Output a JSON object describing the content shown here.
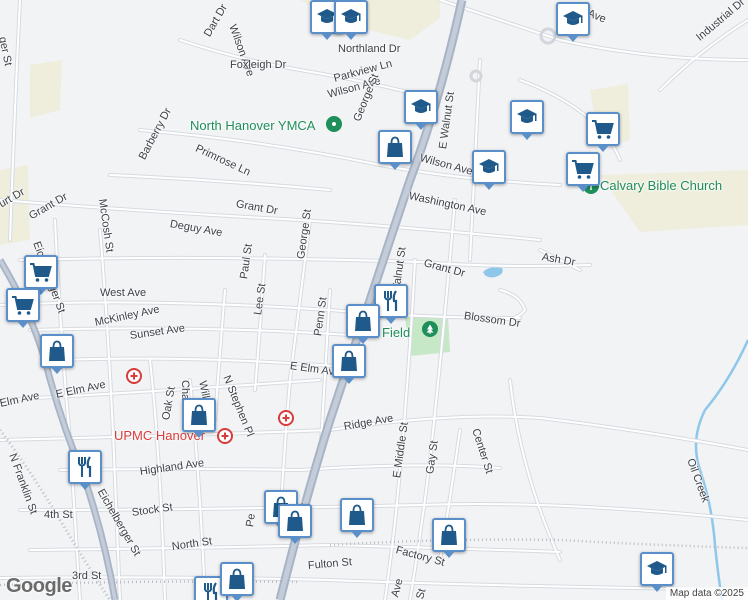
{
  "map": {
    "colors": {
      "background": "#f2f3f5",
      "road": "#ffffff",
      "road_casing": "#d2d6dc",
      "highway": "#a8b4c4",
      "railway": "#b9bec6",
      "water": "#8ec7ea",
      "park": "#c6e8c6",
      "land_tan": "#efeedd",
      "pin_fill": "#1f5a8a",
      "pin_border": "#5b8fc9",
      "poi_green": "#1e8e5a",
      "poi_red": "#d93c3c"
    },
    "street_labels": [
      {
        "text": "Wilson Ave"
      },
      {
        "text": "Dart Dr"
      },
      {
        "text": "Foxleigh Dr"
      },
      {
        "text": "Northland Dr"
      },
      {
        "text": "Parkview Ln"
      },
      {
        "text": "Wilson Ave"
      },
      {
        "text": "George St"
      },
      {
        "text": "E Walnut St"
      },
      {
        "text": "Barberry Dr"
      },
      {
        "text": "Primrose Ln"
      },
      {
        "text": "McCosh St"
      },
      {
        "text": "Wilson Ave"
      },
      {
        "text": "Washington Ave"
      },
      {
        "text": "Grant Dr"
      },
      {
        "text": "Grant Dr"
      },
      {
        "text": "Deguy Ave"
      },
      {
        "text": "George St"
      },
      {
        "text": "Eichelberger St"
      },
      {
        "text": "Paul St"
      },
      {
        "text": "Grant Dr"
      },
      {
        "text": "Ash Dr"
      },
      {
        "text": "West Ave"
      },
      {
        "text": "Lee St"
      },
      {
        "text": "Penn St"
      },
      {
        "text": "Walnut St"
      },
      {
        "text": "McKinley Ave"
      },
      {
        "text": "Blossom Dr"
      },
      {
        "text": "Sunset Ave"
      },
      {
        "text": "N Stephen Pl"
      },
      {
        "text": "Willow St"
      },
      {
        "text": "E Elm Ave"
      },
      {
        "text": "E Elm Ave"
      },
      {
        "text": "Elm Ave"
      },
      {
        "text": "Oak St"
      },
      {
        "text": "Chas"
      },
      {
        "text": "Ridge Ave"
      },
      {
        "text": "E Middle St"
      },
      {
        "text": "Gay St"
      },
      {
        "text": "Center St"
      },
      {
        "text": "N Franklin St"
      },
      {
        "text": "Highland Ave"
      },
      {
        "text": "4th St"
      },
      {
        "text": "Stock St"
      },
      {
        "text": "Eichelberger St"
      },
      {
        "text": "Pe"
      },
      {
        "text": "way"
      },
      {
        "text": "North St"
      },
      {
        "text": "3rd St"
      },
      {
        "text": "Fulton St"
      },
      {
        "text": "Factory St"
      },
      {
        "text": "Ave"
      },
      {
        "text": "Industrial Dr"
      },
      {
        "text": "Ave"
      },
      {
        "text": "Oil Creek"
      },
      {
        "text": "St"
      },
      {
        "text": "urt Dr"
      },
      {
        "text": "ger St"
      }
    ],
    "poi_labels": [
      {
        "text": "North Hanover YMCA",
        "icon": "fitness-icon",
        "color": "#1e8e5a"
      },
      {
        "text": "Calvary Bible Church",
        "icon": "church-icon",
        "color": "#1e8e5a"
      },
      {
        "text": "UPMC Hanover",
        "icon": "hospital-icon",
        "color": "#d93c3c"
      },
      {
        "text": "Field",
        "icon": "park-icon",
        "color": "#1e8e5a"
      }
    ],
    "extra_poi_icons": [
      {
        "icon": "hospital-icon"
      },
      {
        "icon": "hospital-icon"
      }
    ],
    "pins": [
      {
        "icon": "school-icon"
      },
      {
        "icon": "school-icon"
      },
      {
        "icon": "school-icon"
      },
      {
        "icon": "shopping-cart-icon"
      },
      {
        "icon": "school-icon"
      },
      {
        "icon": "shopping-bag-icon"
      },
      {
        "icon": "school-icon"
      },
      {
        "icon": "school-icon"
      },
      {
        "icon": "shopping-cart-icon"
      },
      {
        "icon": "shopping-cart-icon"
      },
      {
        "icon": "restaurant-icon"
      },
      {
        "icon": "shopping-cart-icon"
      },
      {
        "icon": "shopping-bag-icon"
      },
      {
        "icon": "shopping-bag-icon"
      },
      {
        "icon": "shopping-bag-icon"
      },
      {
        "icon": "shopping-bag-icon"
      },
      {
        "icon": "restaurant-icon"
      },
      {
        "icon": "shopping-bag-icon"
      },
      {
        "icon": "shopping-bag-icon"
      },
      {
        "icon": "shopping-bag-icon"
      },
      {
        "icon": "shopping-bag-icon"
      },
      {
        "icon": "restaurant-icon"
      },
      {
        "icon": "shopping-bag-icon"
      },
      {
        "icon": "school-icon"
      }
    ],
    "google_logo": "Google",
    "attribution": "Map data ©2025"
  }
}
